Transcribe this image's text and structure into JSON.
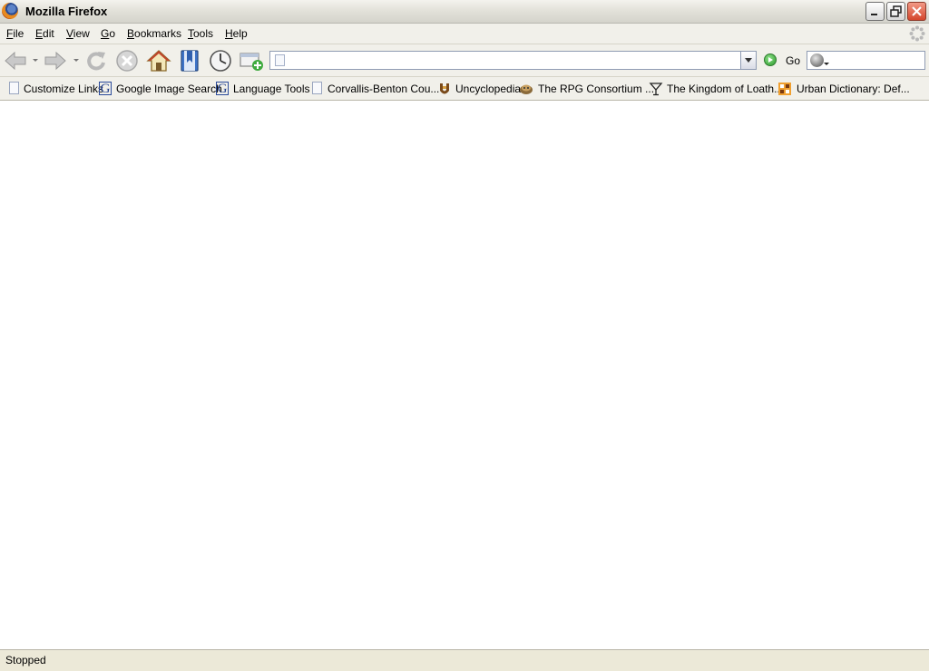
{
  "window": {
    "title": "Mozilla Firefox"
  },
  "menu": {
    "items": [
      {
        "mnemonic": "F",
        "rest": "ile"
      },
      {
        "mnemonic": "E",
        "rest": "dit"
      },
      {
        "mnemonic": "V",
        "rest": "iew"
      },
      {
        "mnemonic": "G",
        "rest": "o"
      },
      {
        "mnemonic": "B",
        "rest": "ookmarks"
      },
      {
        "mnemonic": "T",
        "rest": "ools"
      },
      {
        "mnemonic": "H",
        "rest": "elp"
      }
    ]
  },
  "toolbar": {
    "buttons": [
      "back-icon",
      "forward-icon",
      "reload-icon",
      "stop-icon",
      "home-icon",
      "bookmarks-icon",
      "history-icon",
      "new-tab-icon"
    ],
    "url_value": "",
    "go_label": "Go",
    "search_value": ""
  },
  "bookmarks": {
    "items": [
      {
        "label": "Customize Links",
        "icon": "page-icon"
      },
      {
        "label": "Google Image Search",
        "icon": "google-icon"
      },
      {
        "label": "Language Tools",
        "icon": "google-icon"
      },
      {
        "label": "Corvallis-Benton Cou...",
        "icon": "page-icon"
      },
      {
        "label": "Uncyclopedia",
        "icon": "uncyclopedia-icon"
      },
      {
        "label": "The RPG Consortium ...",
        "icon": "rpg-icon"
      },
      {
        "label": "The Kingdom of Loath...",
        "icon": "martini-icon"
      },
      {
        "label": "Urban Dictionary: Def...",
        "icon": "urban-dictionary-icon"
      }
    ]
  },
  "status": {
    "text": "Stopped"
  }
}
